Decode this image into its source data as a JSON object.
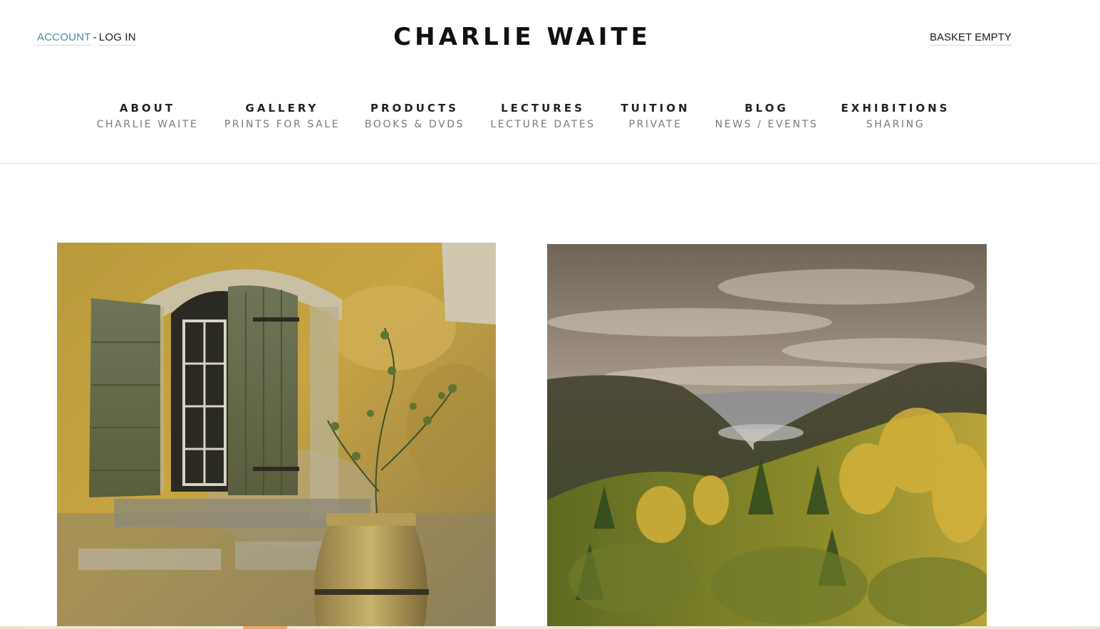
{
  "header": {
    "account_label": "ACCOUNT",
    "separator": "-",
    "login_label": "LOG IN",
    "logo_text": "CHARLIE WAITE",
    "basket_label": "BASKET EMPTY"
  },
  "nav": [
    {
      "title": "ABOUT",
      "subtitle": "CHARLIE WAITE"
    },
    {
      "title": "GALLERY",
      "subtitle": "PRINTS FOR SALE"
    },
    {
      "title": "PRODUCTS",
      "subtitle": "BOOKS & DVDS"
    },
    {
      "title": "LECTURES",
      "subtitle": "LECTURE DATES"
    },
    {
      "title": "TUITION",
      "subtitle": "PRIVATE"
    },
    {
      "title": "BLOG",
      "subtitle": "NEWS / EVENTS"
    },
    {
      "title": "EXHIBITIONS",
      "subtitle": "SHARING"
    }
  ],
  "colors": {
    "account_link": "#4a8a9c",
    "nav_title": "#222222",
    "nav_subtitle": "#7a7a7a",
    "divider": "#e6e6e6"
  }
}
